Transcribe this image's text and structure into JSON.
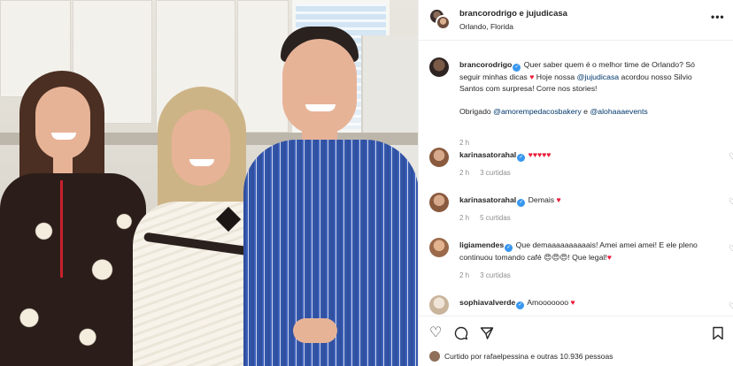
{
  "post": {
    "header": {
      "names": "brancorodrigo e jujudicasa",
      "location": "Orlando, Florida",
      "more_icon": "more-horizontal-icon"
    },
    "caption": {
      "username": "brancorodrigo",
      "text1": "Quer saber quem é o melhor time de Orlando? Só seguir minhas dicas",
      "text2": " Hoje nossa ",
      "mention1": "@jujudicasa",
      "text3": " acordou nosso Silvio Santos com surpresa! Corre nos stories!",
      "thanks": "Obrigado ",
      "mention2": "@amorempedacosbakery",
      "and": " e ",
      "mention3": "@alohaaaevents",
      "time": "2 h"
    },
    "comments": [
      {
        "username": "karinasatorahal",
        "text": "",
        "hearts": "♥♥♥♥♥",
        "time": "2 h",
        "likes": "3 curtidas"
      },
      {
        "username": "karinasatorahal",
        "text": "Demais",
        "hearts": "♥",
        "time": "2 h",
        "likes": "5 curtidas"
      },
      {
        "username": "ligiamendes",
        "text": "Que demaaaaaaaaaais! Amei amei amei! E ele pleno continuou tomando café",
        "emoji": "😍😍😍",
        "text_b": "! Que legal!",
        "hearts": "♥",
        "time": "2 h",
        "likes": "3 curtidas"
      },
      {
        "username": "sophiavalverde",
        "text": "Amooooooo",
        "hearts": "♥"
      }
    ],
    "liked_by": {
      "prefix": "Curtido por ",
      "user": "rafaelpessina",
      "suffix": " e outras 10.936 pessoas"
    },
    "icons": {
      "like": "heart-icon",
      "comment": "comment-icon",
      "share": "share-icon",
      "save": "bookmark-icon"
    }
  },
  "colors": {
    "verified": "#3897f0",
    "heart": "#ed1c3a",
    "mention": "#00376b",
    "meta": "#8e8e8e"
  }
}
